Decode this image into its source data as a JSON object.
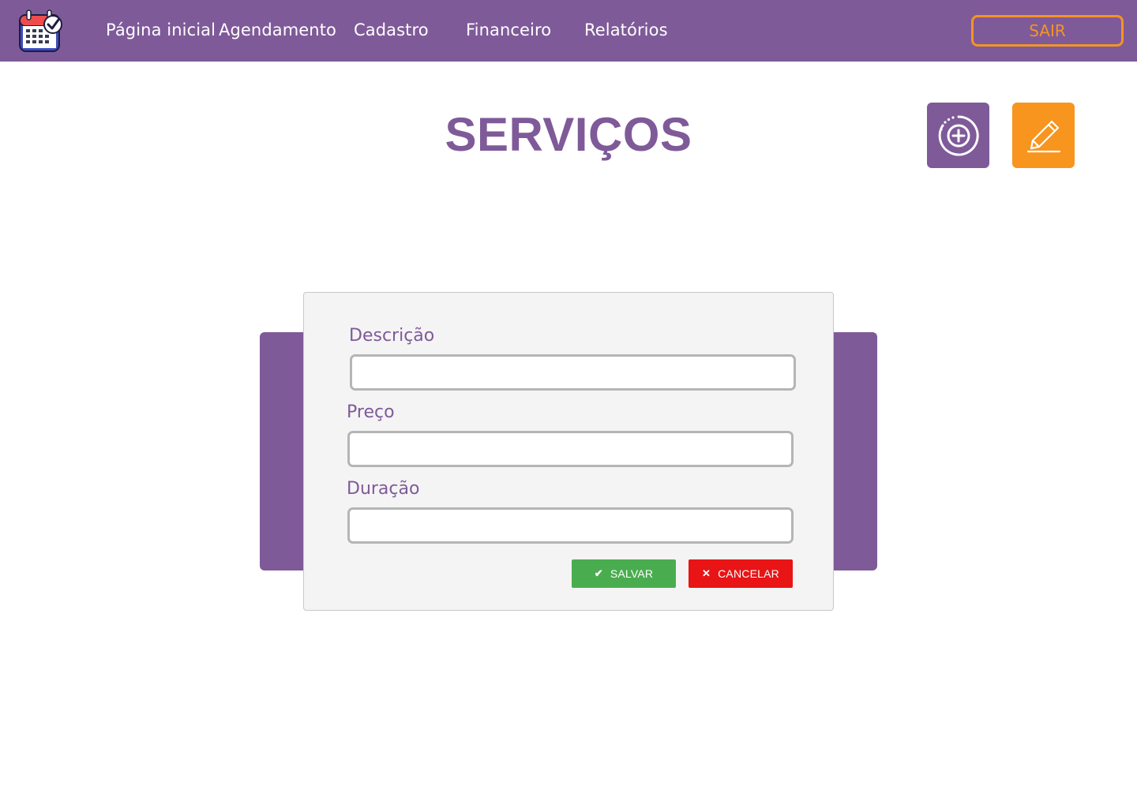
{
  "app": {
    "logo_icon": "calendar-check-icon"
  },
  "nav": {
    "items": [
      {
        "label": "Página inicial"
      },
      {
        "label": "Agendamento"
      },
      {
        "label": "Cadastro"
      },
      {
        "label": "Financeiro"
      },
      {
        "label": "Relatórios"
      }
    ],
    "logout_label": "SAIR"
  },
  "page": {
    "title": "SERVIÇOS",
    "actions": {
      "add_icon": "plus-circle-icon",
      "edit_icon": "pencil-icon"
    }
  },
  "form": {
    "fields": [
      {
        "label": "Descrição",
        "value": "",
        "placeholder": ""
      },
      {
        "label": "Preço",
        "value": "",
        "placeholder": ""
      },
      {
        "label": "Duração",
        "value": "",
        "placeholder": ""
      }
    ],
    "save_label": "SALVAR",
    "save_icon": "check-icon",
    "cancel_label": "CANCELAR",
    "cancel_icon": "close-icon"
  },
  "colors": {
    "brand_purple": "#7f5a99",
    "accent_orange": "#f7951e",
    "save_green": "#49ad4f",
    "cancel_red": "#e81416"
  }
}
